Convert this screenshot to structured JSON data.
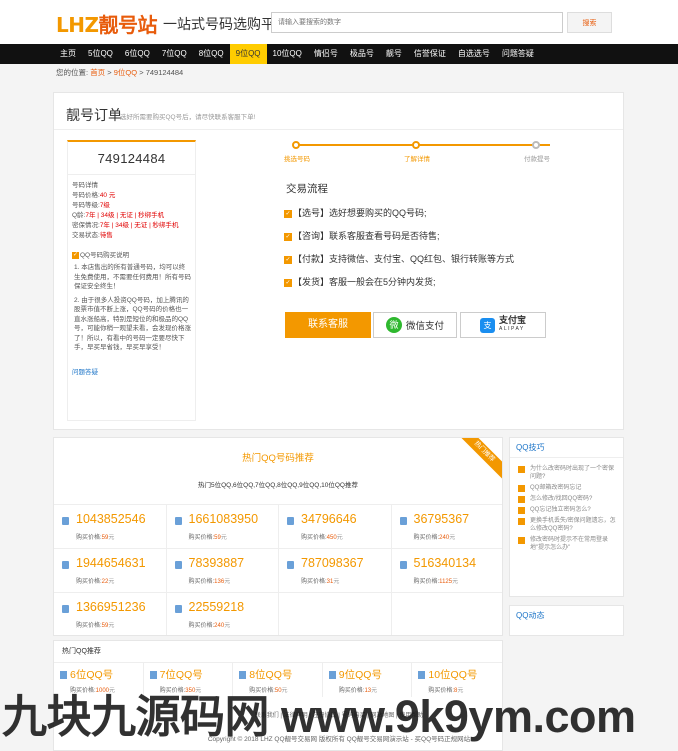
{
  "header": {
    "logo_mark": "LHZ",
    "logo_name": "靓号站",
    "slogan": "一站式号码选购平台",
    "search_placeholder": "请输入要搜索的数字",
    "search_button": "搜索"
  },
  "nav": [
    {
      "label": "主页",
      "active": false
    },
    {
      "label": "5位QQ",
      "active": false
    },
    {
      "label": "6位QQ",
      "active": false
    },
    {
      "label": "7位QQ",
      "active": false
    },
    {
      "label": "8位QQ",
      "active": false
    },
    {
      "label": "9位QQ",
      "active": true
    },
    {
      "label": "10位QQ",
      "active": false
    },
    {
      "label": "情侣号",
      "active": false
    },
    {
      "label": "极品号",
      "active": false
    },
    {
      "label": "靓号",
      "active": false
    },
    {
      "label": "信誉保证",
      "active": false
    },
    {
      "label": "自选选号",
      "active": false
    },
    {
      "label": "问题答疑",
      "active": false
    }
  ],
  "breadcrumb": {
    "prefix": "您的位置:",
    "home": "首页",
    "sep": ">",
    "category": "9位QQ",
    "current": "749124484"
  },
  "order": {
    "title": "靓号订单",
    "subtitle": "选好所需要购买QQ号后，请尽快联系客服下单!",
    "number": "749124484",
    "details_title": "号码详情",
    "rows": [
      {
        "label": "号码价格:",
        "value": "40 元"
      },
      {
        "label": "号码等级:",
        "value": "7级"
      },
      {
        "label": "Q龄:",
        "value": "7年 | 34级 | 无证 | 秒绑手机"
      },
      {
        "label": "密保情况:",
        "value": "7年 | 34级 | 无证 | 秒绑手机"
      },
      {
        "label": "交易状态:",
        "value": "待售"
      }
    ],
    "note_title": "QQ号码购买说明",
    "notes": [
      "1. 本店售出的所有普通号码，均可以终生免费使用，不需要任何费用！所有号码保证安全终生！",
      "2. 由于很多人投资QQ号码，加上腾讯的股票市值不断上涨，QQ号码的价格也一直水涨船高，特别是短位的和极品的QQ号，可能你稍一观望未看，会发现价格涨了！所以，有看中的号码一定要尽快下手，早买早省钱，早买早享受！"
    ],
    "help_link": "问题答疑"
  },
  "steps": [
    {
      "label": "挑选号码",
      "done": true
    },
    {
      "label": "了解详情",
      "done": true
    },
    {
      "label": "付款提号",
      "done": false
    }
  ],
  "flow": {
    "title": "交易流程",
    "items": [
      "【选号】选好想要购买的QQ号码;",
      "【咨询】联系客服查看号码是否待售;",
      "【付款】支持微信、支付宝、QQ红包、银行转账等方式",
      "【发货】客服一般会在5分钟内发货;"
    ]
  },
  "pay": {
    "contact": "联系客服",
    "wechat_icon": "微",
    "wechat": "微信支付",
    "alipay_icon": "支",
    "alipay": "支付宝",
    "alipay_en": "ALIPAY"
  },
  "hot": {
    "title": "热门QQ号码推荐",
    "ribbon": "热门推荐",
    "subtitle": "热门5位QQ,6位QQ,7位QQ,8位QQ,9位QQ,10位QQ推荐",
    "price_label": "购买价格:",
    "price_unit": "元",
    "items": [
      {
        "number": "1043852546",
        "price": "59"
      },
      {
        "number": "1661083950",
        "price": "59"
      },
      {
        "number": "34796646",
        "price": "450"
      },
      {
        "number": "36795367",
        "price": "240"
      },
      {
        "number": "1944654631",
        "price": "22"
      },
      {
        "number": "78393887",
        "price": "136"
      },
      {
        "number": "787098367",
        "price": "31"
      },
      {
        "number": "516340134",
        "price": "1125"
      },
      {
        "number": "1366951236",
        "price": "59"
      },
      {
        "number": "22559218",
        "price": "240"
      }
    ]
  },
  "side_qa": {
    "title": "QQ技巧",
    "items": [
      "为什么改密码时出现了一个密保问题?",
      "QQ邮箱改密码忘记",
      "怎么修改/找回QQ密码?",
      "QQ忘记独立密码怎么?",
      "更换手机丢失/密保问题遗忘，怎么修改QQ密码?",
      "修改密码时提示不在常用登录地\"提示怎么办\""
    ]
  },
  "side_news": {
    "title": "QQ动态"
  },
  "cats": {
    "title": "热门QQ推荐",
    "price_label": "购买价格:",
    "price_unit": "元",
    "items": [
      {
        "name": "6位QQ号",
        "price": "1000"
      },
      {
        "name": "7位QQ号",
        "price": "350"
      },
      {
        "name": "8位QQ号",
        "price": "50"
      },
      {
        "name": "9位QQ号",
        "price": "13"
      },
      {
        "name": "10位QQ号",
        "price": "8"
      }
    ]
  },
  "footer": {
    "links": "联系我们 | 法律声明 | 注册协议 | 号码购买 | 网站地图 | 使用帮助",
    "copy": "Copyright © 2018 LHZ QQ靓号交易网 版权所有",
    "site": "QQ靓号交易网演示站 - 买QQ号码正规网站"
  },
  "watermark": "九块九源码网 www.9k9ym.com"
}
